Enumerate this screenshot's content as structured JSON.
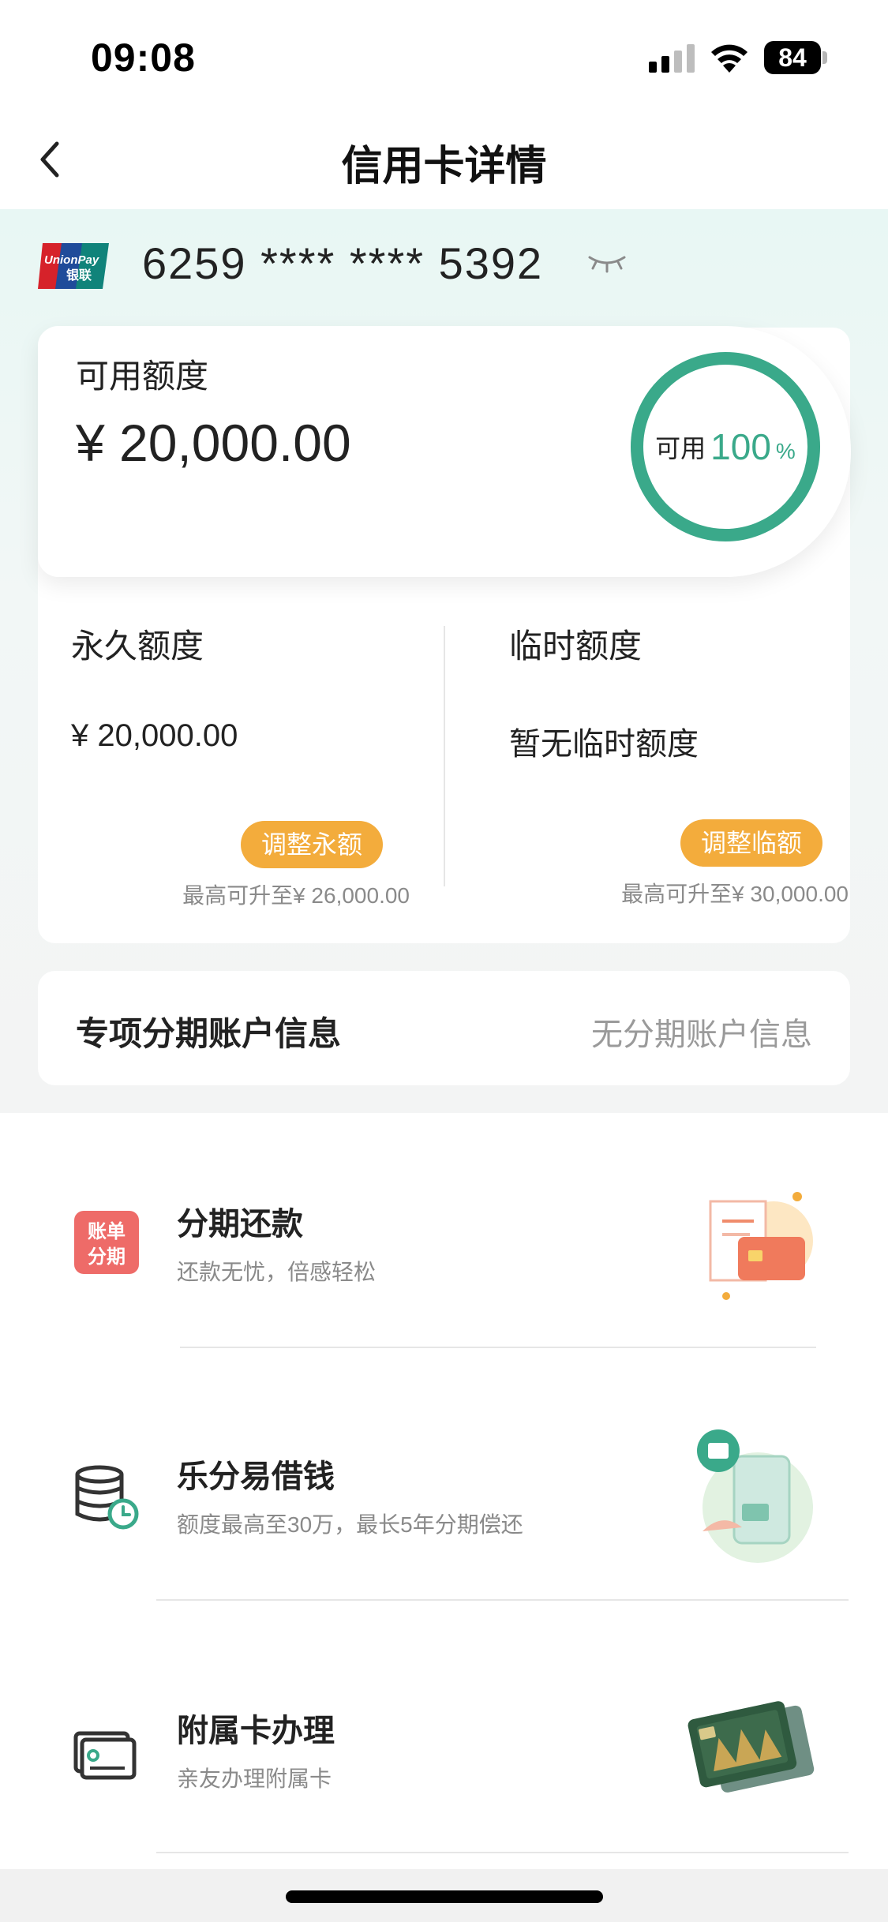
{
  "status_bar": {
    "time": "09:08",
    "battery": "84"
  },
  "nav": {
    "title": "信用卡详情",
    "back_icon": "chevron-left-icon"
  },
  "card": {
    "brand_text": "UnionPay",
    "brand_cn": "银联",
    "number": "6259 **** **** 5392",
    "visibility_icon": "eye-closed-icon"
  },
  "available": {
    "label": "可用额度",
    "amount": "¥ 20,000.00",
    "ring_label": "可用",
    "ring_percent": "100",
    "ring_unit": "%",
    "ring_value": 100
  },
  "permanent": {
    "title": "永久额度",
    "value": "¥ 20,000.00",
    "button": "调整永额",
    "max_note": "最高可升至¥ 26,000.00"
  },
  "temporary": {
    "title": "临时额度",
    "value": "暂无临时额度",
    "button": "调整临额",
    "max_note": "最高可升至¥ 30,000.00"
  },
  "installment_account": {
    "title": "专项分期账户信息",
    "value": "无分期账户信息"
  },
  "services": [
    {
      "title": "分期还款",
      "subtitle": "还款无忧，倍感轻松",
      "icon": "bill-installment-icon",
      "icon_text_1": "账单",
      "icon_text_2": "分期"
    },
    {
      "title": "乐分易借钱",
      "subtitle": "额度最高至30万，最长5年分期偿还",
      "icon": "coin-stack-clock-icon"
    },
    {
      "title": "附属卡办理",
      "subtitle": "亲友办理附属卡",
      "icon": "card-icon"
    }
  ],
  "colors": {
    "accent_green": "#3aa98a",
    "button_orange": "#f3ac3c"
  }
}
